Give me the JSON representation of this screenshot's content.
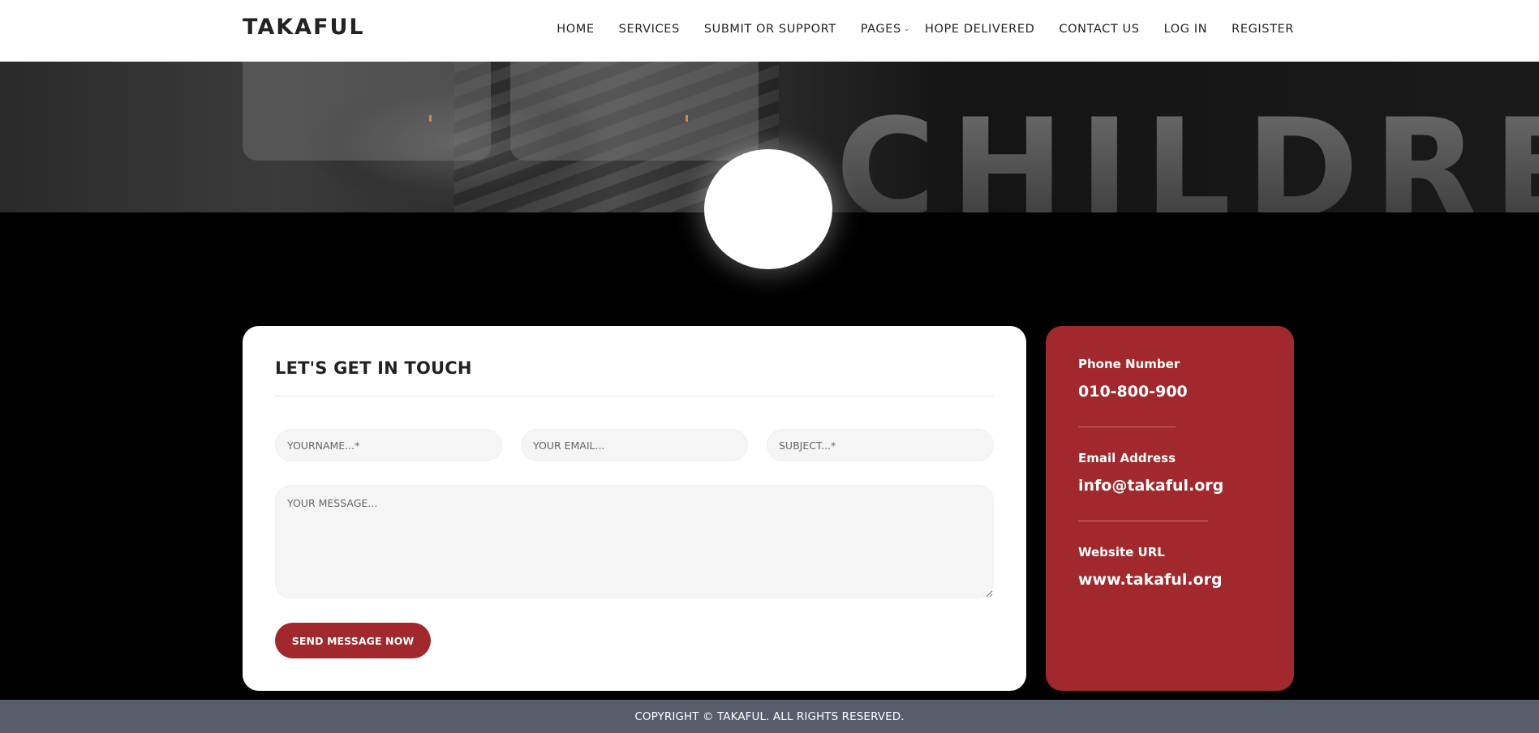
{
  "brand": {
    "logo": "TAKAFUL"
  },
  "nav": {
    "items": [
      {
        "label": "HOME"
      },
      {
        "label": "SERVICES"
      },
      {
        "label": "SUBMIT OR SUPPORT"
      },
      {
        "label": "PAGES",
        "has_dropdown": true
      },
      {
        "label": "HOPE DELIVERED"
      },
      {
        "label": "CONTACT US"
      },
      {
        "label": "LOG IN"
      },
      {
        "label": "REGISTER"
      }
    ],
    "dropdown_icon": "chevron-down-icon"
  },
  "hero": {
    "big_word": "CHILDREN"
  },
  "contact_form": {
    "title": "LET'S GET IN TOUCH",
    "name_placeholder": "YOURNAME...*",
    "email_placeholder": "YOUR EMAIL...",
    "subject_placeholder": "SUBJECT...*",
    "message_placeholder": "YOUR MESSAGE...",
    "submit_label": "SEND MESSAGE NOW"
  },
  "contact_info": {
    "phone_label": "Phone Number",
    "phone_value": "010-800-900",
    "email_label": "Email Address",
    "email_value": "info@takaful.org",
    "website_label": "Website URL",
    "website_value": "www.takaful.org"
  },
  "footer": {
    "copyright": "COPYRIGHT © TAKAFUL. ALL RIGHTS RESERVED."
  },
  "colors": {
    "accent": "#a1282c",
    "footer_bg": "#575d6b",
    "page_bg": "#000000",
    "header_bg": "#ffffff"
  }
}
